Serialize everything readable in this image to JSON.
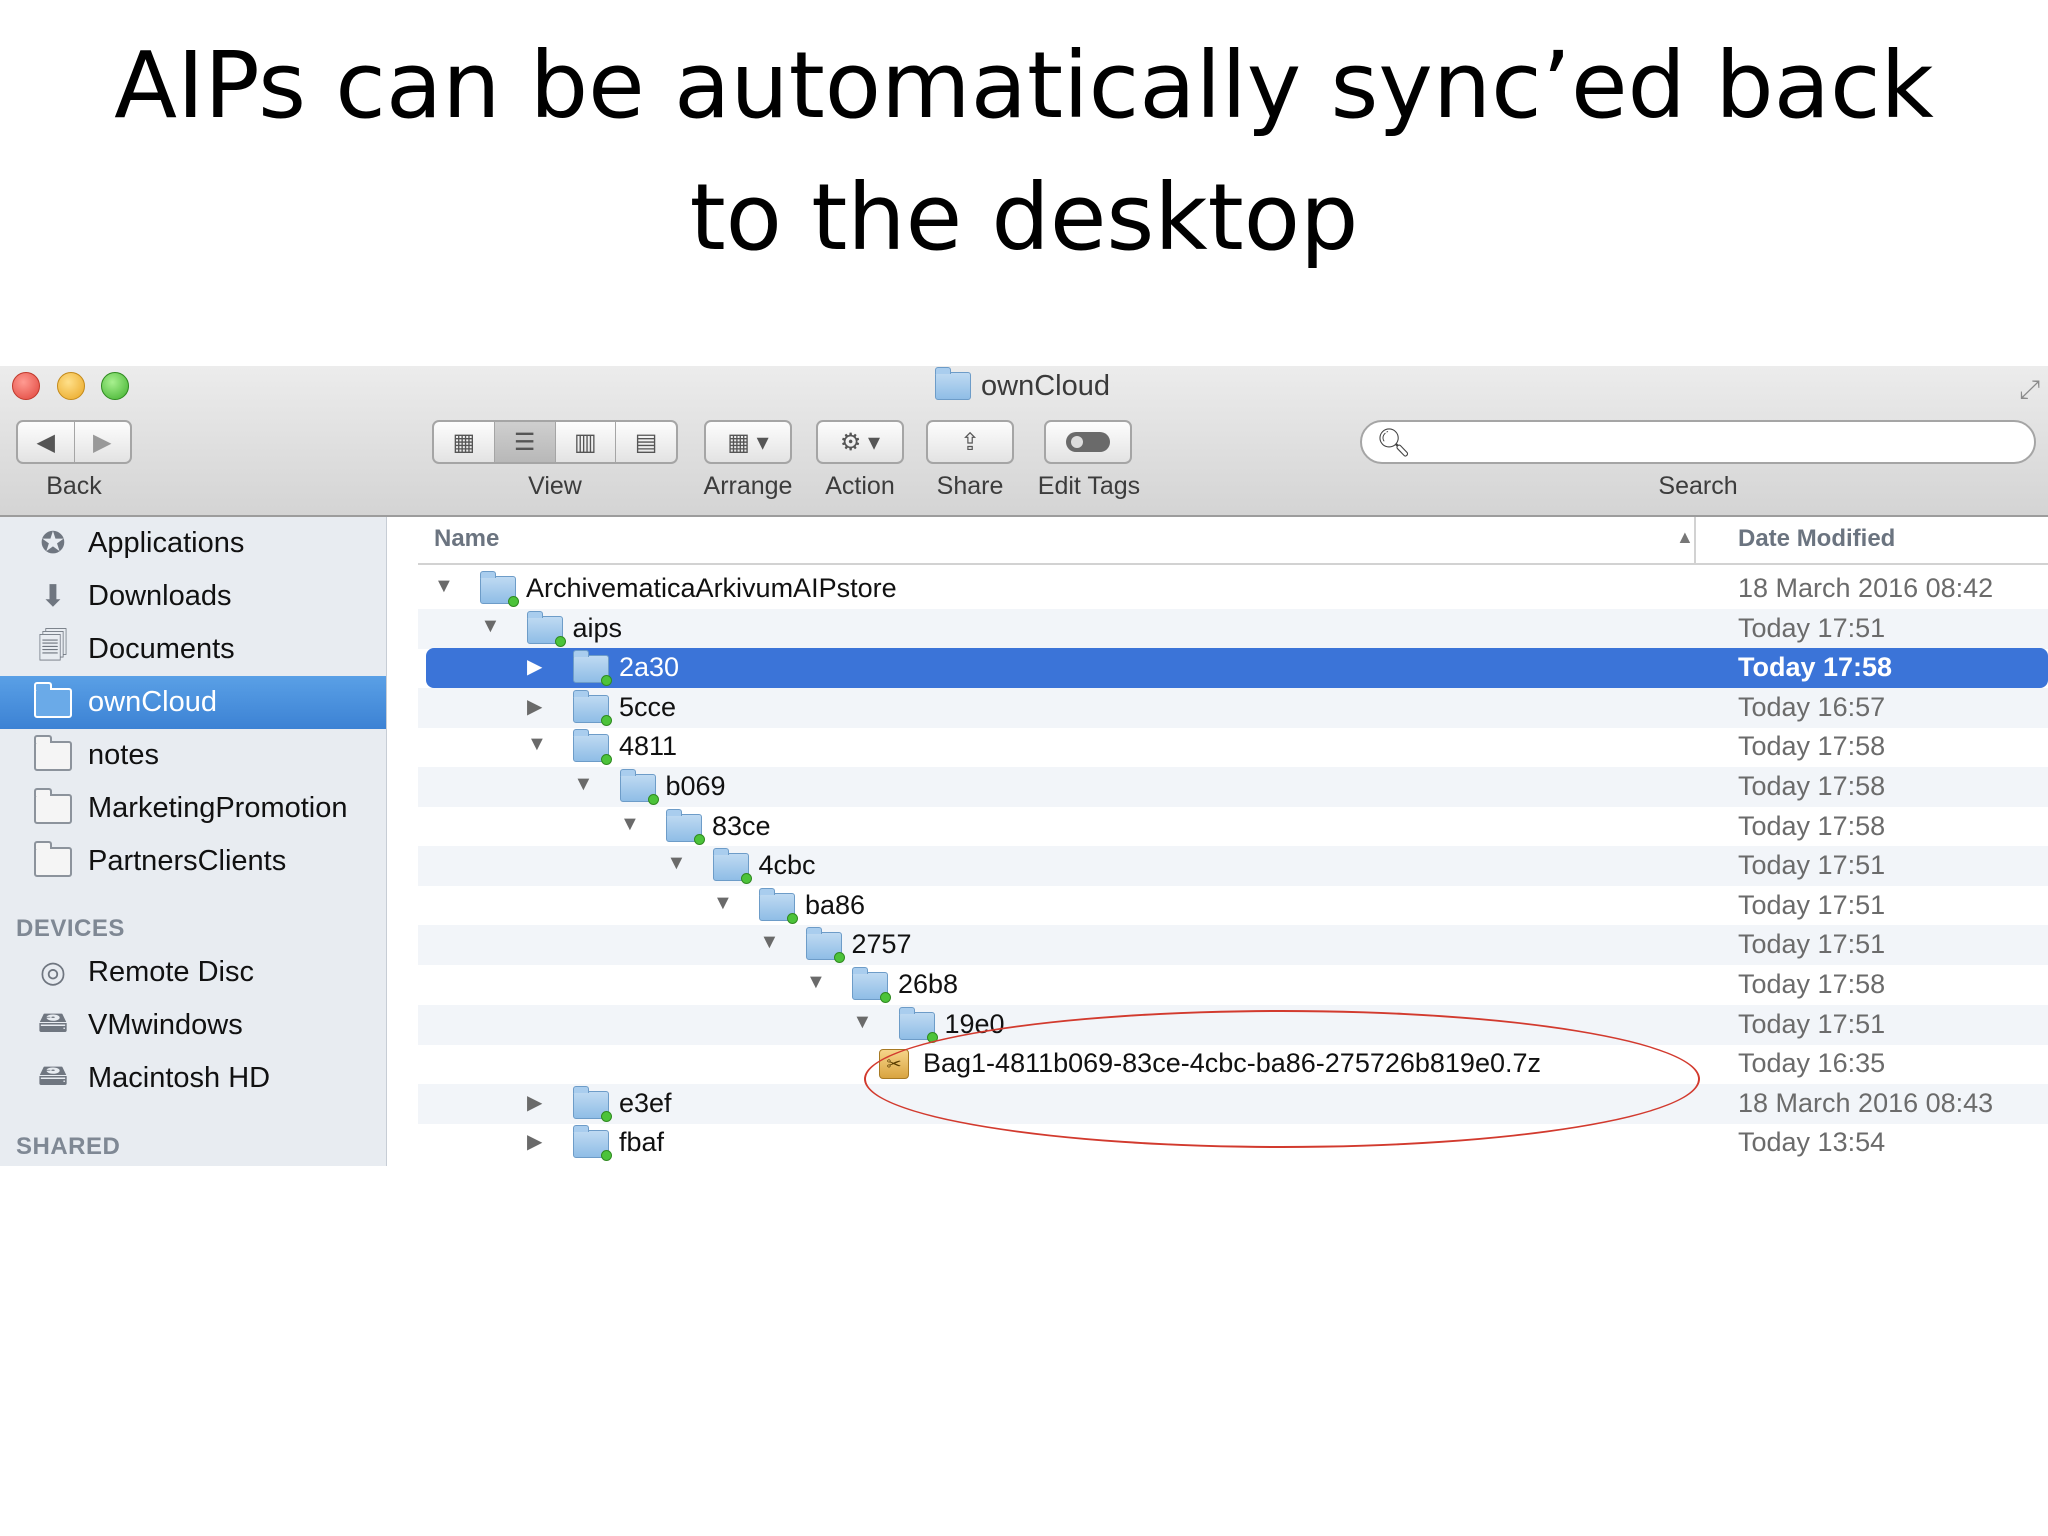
{
  "slide": {
    "title_line1": "AIPs can be automatically sync’ed back",
    "title_line2": "to the desktop"
  },
  "window": {
    "title": "ownCloud",
    "toolbar": {
      "back_label": "Back",
      "view_label": "View",
      "arrange_label": "Arrange",
      "action_label": "Action",
      "share_label": "Share",
      "edit_tags_label": "Edit Tags",
      "search_label": "Search",
      "search_placeholder": ""
    }
  },
  "sidebar": {
    "favorites": [
      {
        "label": "Applications",
        "icon": "applications-icon"
      },
      {
        "label": "Downloads",
        "icon": "downloads-icon"
      },
      {
        "label": "Documents",
        "icon": "documents-icon"
      },
      {
        "label": "ownCloud",
        "icon": "folder-icon",
        "selected": true
      },
      {
        "label": "notes",
        "icon": "folder-icon"
      },
      {
        "label": "MarketingPromotion",
        "icon": "folder-icon"
      },
      {
        "label": "PartnersClients",
        "icon": "folder-icon"
      }
    ],
    "devices_header": "DEVICES",
    "devices": [
      {
        "label": "Remote Disc",
        "icon": "disc-icon"
      },
      {
        "label": "VMwindows",
        "icon": "drive-icon"
      },
      {
        "label": "Macintosh HD",
        "icon": "drive-icon"
      }
    ],
    "shared_header": "SHARED"
  },
  "list": {
    "col_name": "Name",
    "col_date": "Date Modified",
    "rows": [
      {
        "name": "ArchivematicaArkivumAIPstore",
        "date": "18 March 2016 08:42",
        "level": 0,
        "expanded": true
      },
      {
        "name": "aips",
        "date": "Today 17:51",
        "level": 1,
        "expanded": true
      },
      {
        "name": "2a30",
        "date": "Today 17:58",
        "level": 2,
        "expanded": false,
        "selected": true
      },
      {
        "name": "5cce",
        "date": "Today 16:57",
        "level": 2,
        "expanded": false
      },
      {
        "name": "4811",
        "date": "Today 17:58",
        "level": 2,
        "expanded": true
      },
      {
        "name": "b069",
        "date": "Today 17:58",
        "level": 3,
        "expanded": true
      },
      {
        "name": "83ce",
        "date": "Today 17:58",
        "level": 4,
        "expanded": true
      },
      {
        "name": "4cbc",
        "date": "Today 17:51",
        "level": 5,
        "expanded": true
      },
      {
        "name": "ba86",
        "date": "Today 17:51",
        "level": 6,
        "expanded": true
      },
      {
        "name": "2757",
        "date": "Today 17:51",
        "level": 7,
        "expanded": true
      },
      {
        "name": "26b8",
        "date": "Today 17:58",
        "level": 8,
        "expanded": true
      },
      {
        "name": "19e0",
        "date": "Today 17:51",
        "level": 9,
        "expanded": true
      },
      {
        "name": "Bag1-4811b069-83ce-4cbc-ba86-275726b819e0.7z",
        "date": "Today 16:35",
        "level": 10,
        "file": true
      },
      {
        "name": "e3ef",
        "date": "18 March 2016 08:43",
        "level": 2,
        "expanded": false
      },
      {
        "name": "fbaf",
        "date": "Today 13:54",
        "level": 2,
        "expanded": false
      }
    ]
  },
  "colors": {
    "selection": "#3b74d8",
    "annotation": "#d23a2e",
    "sidebar_bg": "#e8ecf1"
  }
}
